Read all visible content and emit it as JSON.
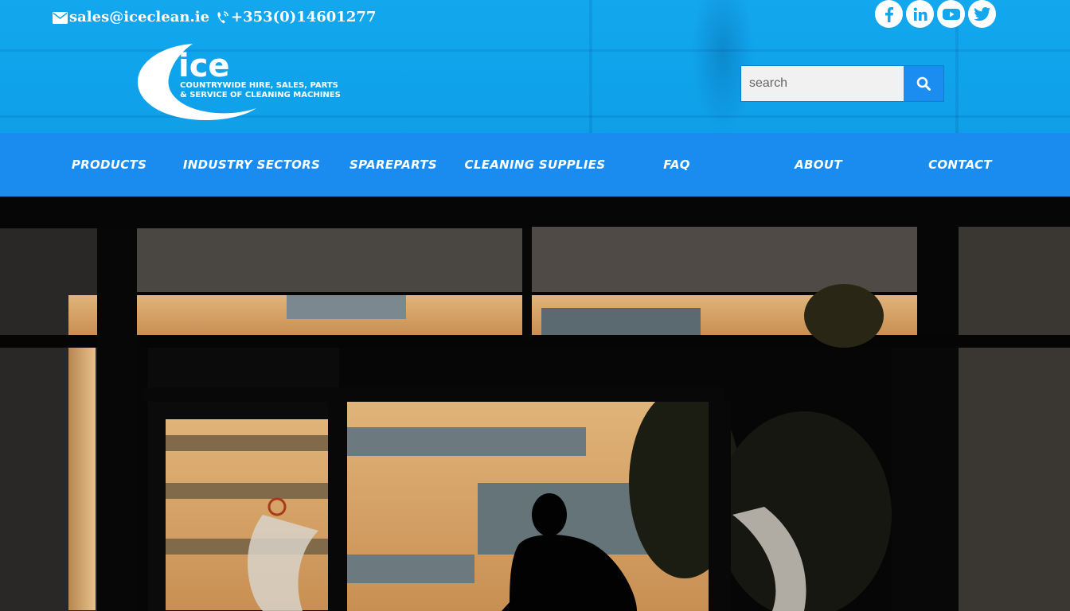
{
  "topbar": {
    "email": "sales@iceclean.ie",
    "phone": "+353(0)14601277",
    "socials": [
      {
        "name": "facebook",
        "icon": "facebook-icon"
      },
      {
        "name": "linkedin",
        "icon": "linkedin-icon"
      },
      {
        "name": "youtube",
        "icon": "youtube-icon"
      },
      {
        "name": "twitter",
        "icon": "twitter-icon"
      }
    ]
  },
  "logo": {
    "wordmark": "ice",
    "tagline_line1": "COUNTRYWIDE HIRE, SALES, PARTS",
    "tagline_line2": "& SERVICE OF CLEANING MACHINES"
  },
  "search": {
    "placeholder": "search"
  },
  "nav": {
    "items": [
      {
        "label": "PRODUCTS"
      },
      {
        "label": "INDUSTRY SECTORS"
      },
      {
        "label": "SPAREPARTS"
      },
      {
        "label": "CLEANING SUPPLIES"
      },
      {
        "label": "FAQ"
      },
      {
        "label": "ABOUT"
      },
      {
        "label": "CONTACT"
      }
    ]
  },
  "colors": {
    "header_bg": "#13a7ee",
    "nav_bg": "#1a8cf0",
    "search_button": "#1c8df0",
    "text": "#ffffff"
  }
}
